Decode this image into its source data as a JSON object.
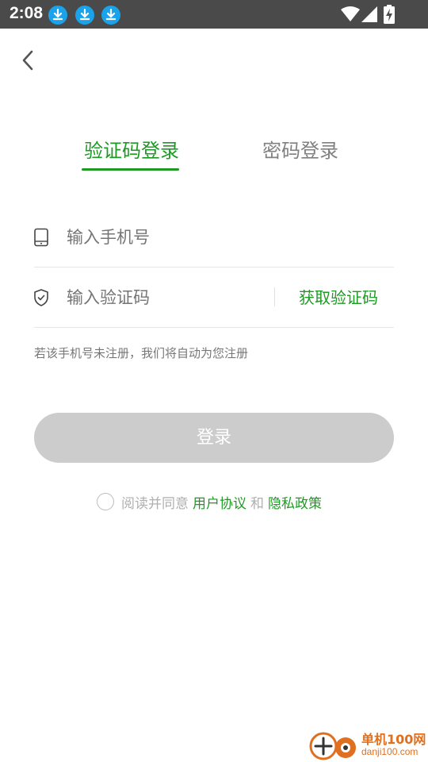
{
  "status_bar": {
    "time": "2:08",
    "notification_icons": [
      "download-icon",
      "download-icon",
      "download-icon"
    ],
    "right_icons": [
      "wifi-icon",
      "signal-icon",
      "battery-charging-icon"
    ]
  },
  "nav": {
    "back_icon": "chevron-left-icon"
  },
  "tabs": [
    {
      "label": "验证码登录",
      "active": true
    },
    {
      "label": "密码登录",
      "active": false
    }
  ],
  "form": {
    "phone": {
      "placeholder": "输入手机号",
      "value": "",
      "icon": "phone-icon"
    },
    "code": {
      "placeholder": "输入验证码",
      "value": "",
      "icon": "shield-icon"
    },
    "get_code_label": "获取验证码",
    "hint": "若该手机号未注册，我们将自动为您注册",
    "submit_label": "登录"
  },
  "agreement": {
    "prefix": "阅读并同意",
    "user_agreement": "用户协议",
    "conjunction": "和",
    "privacy_policy": "隐私政策",
    "checked": false
  },
  "watermark": {
    "title": "单机100网",
    "url": "danji100.com"
  },
  "colors": {
    "accent": "#1e9a24",
    "status_bar": "#4a4a4a",
    "disabled_button": "#cccccc",
    "placeholder": "#bdbdbd",
    "download_badge": "#1aa3ea"
  }
}
